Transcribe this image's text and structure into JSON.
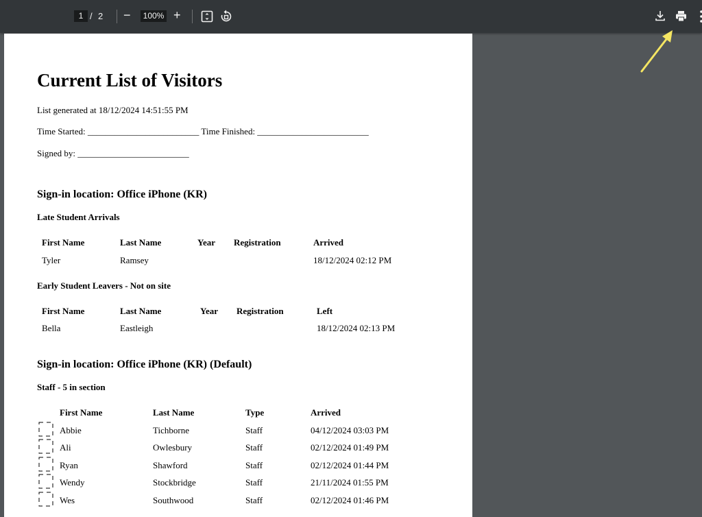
{
  "toolbar": {
    "page_current": "1",
    "page_separator": "/",
    "page_total": "2",
    "zoom_out": "−",
    "zoom_value": "100%",
    "zoom_in": "+"
  },
  "document": {
    "title": "Current List of Visitors",
    "generated": "List generated at 18/12/2024 14:51:55 PM",
    "time_line": "Time Started: _________________________ Time Finished: _________________________",
    "signed_line": "Signed by: _________________________",
    "sections": [
      {
        "heading": "Sign-in location: Office iPhone (KR)",
        "groups": [
          {
            "heading": "Late Student Arrivals",
            "columns": [
              "First Name",
              "Last Name",
              "Year",
              "Registration",
              "Arrived"
            ],
            "rows": [
              [
                "Tyler",
                "Ramsey",
                "",
                "",
                "18/12/2024 02:12 PM"
              ]
            ]
          },
          {
            "heading": "Early Student Leavers - Not on site",
            "columns": [
              "First Name",
              "Last Name",
              "Year",
              "Registration",
              "Left"
            ],
            "rows": [
              [
                "Bella",
                "Eastleigh",
                "",
                "",
                "18/12/2024 02:13 PM"
              ]
            ]
          }
        ]
      },
      {
        "heading": "Sign-in location: Office iPhone (KR) (Default)",
        "groups": [
          {
            "heading": "Staff - 5 in section",
            "columns": [
              "First Name",
              "Last Name",
              "Type",
              "Arrived"
            ],
            "rows": [
              [
                "Abbie",
                "Tichborne",
                "Staff",
                "04/12/2024 03:03 PM"
              ],
              [
                "Ali",
                "Owlesbury",
                "Staff",
                "02/12/2024 01:49 PM"
              ],
              [
                "Ryan",
                "Shawford",
                "Staff",
                "02/12/2024 01:44 PM"
              ],
              [
                "Wendy",
                "Stockbridge",
                "Staff",
                "21/11/2024 01:55 PM"
              ],
              [
                "Wes",
                "Southwood",
                "Staff",
                "02/12/2024 01:46 PM"
              ]
            ]
          }
        ]
      }
    ]
  },
  "colors": {
    "toolbar_bg": "#323639",
    "viewer_bg": "#525659",
    "annotation_arrow": "#f5e663"
  },
  "icons": [
    "minus-icon",
    "plus-icon",
    "fit-page-icon",
    "rotate-icon",
    "download-icon",
    "print-icon",
    "more-vert-icon"
  ]
}
